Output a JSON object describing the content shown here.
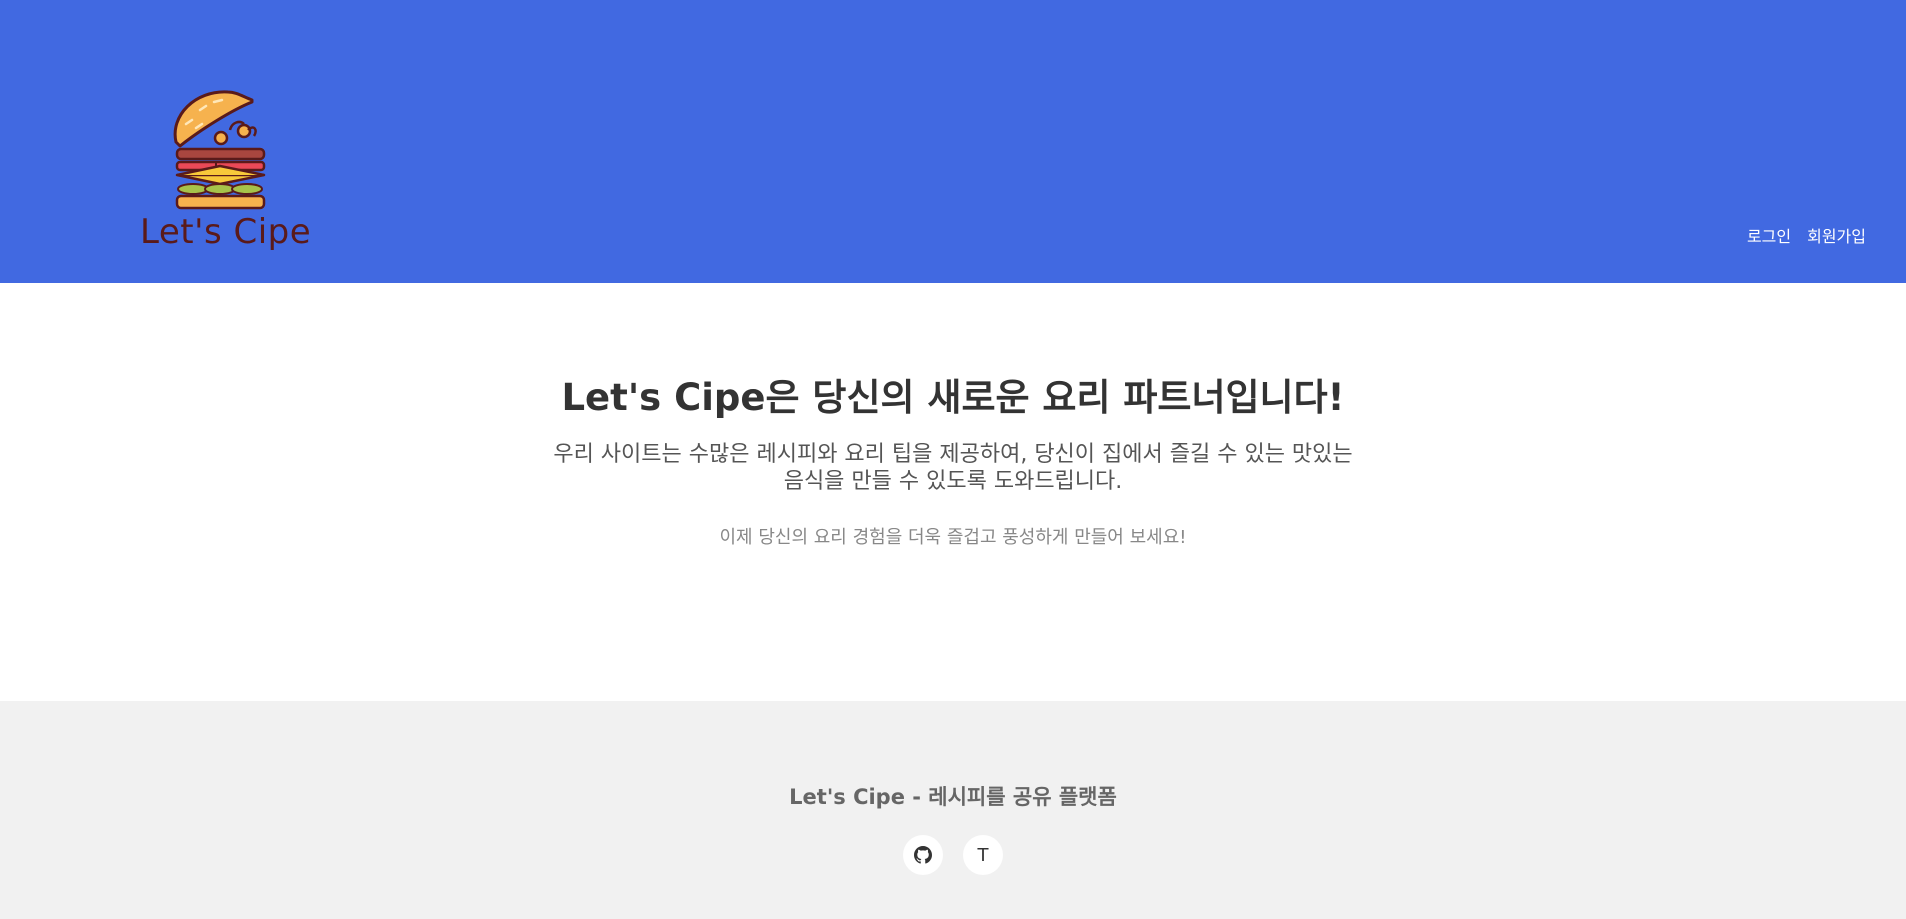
{
  "header": {
    "logo": {
      "text": "Let's Cipe",
      "icon": "burger-icon"
    },
    "nav": {
      "login_label": "로그인",
      "signup_label": "회원가입"
    },
    "background_color": "#4169e1"
  },
  "hero": {
    "title": "Let's Cipe은 당신의 새로운 요리 파트너입니다!",
    "description": "우리 사이트는 수많은 레시피와 요리 팁을 제공하여, 당신이 집에서 즐길 수 있는 맛있는 음식을 만들 수 있도록 도와드립니다.",
    "subtext": "이제 당신의 요리 경험을 더욱 즐겁고 풍성하게 만들어 보세요!"
  },
  "footer": {
    "title": "Let's Cipe - 레시피를 공유 플랫폼",
    "social": [
      {
        "icon": "github-icon"
      },
      {
        "icon": "tistory-icon",
        "glyph": "T"
      }
    ],
    "background_color": "#f1f1f1"
  }
}
